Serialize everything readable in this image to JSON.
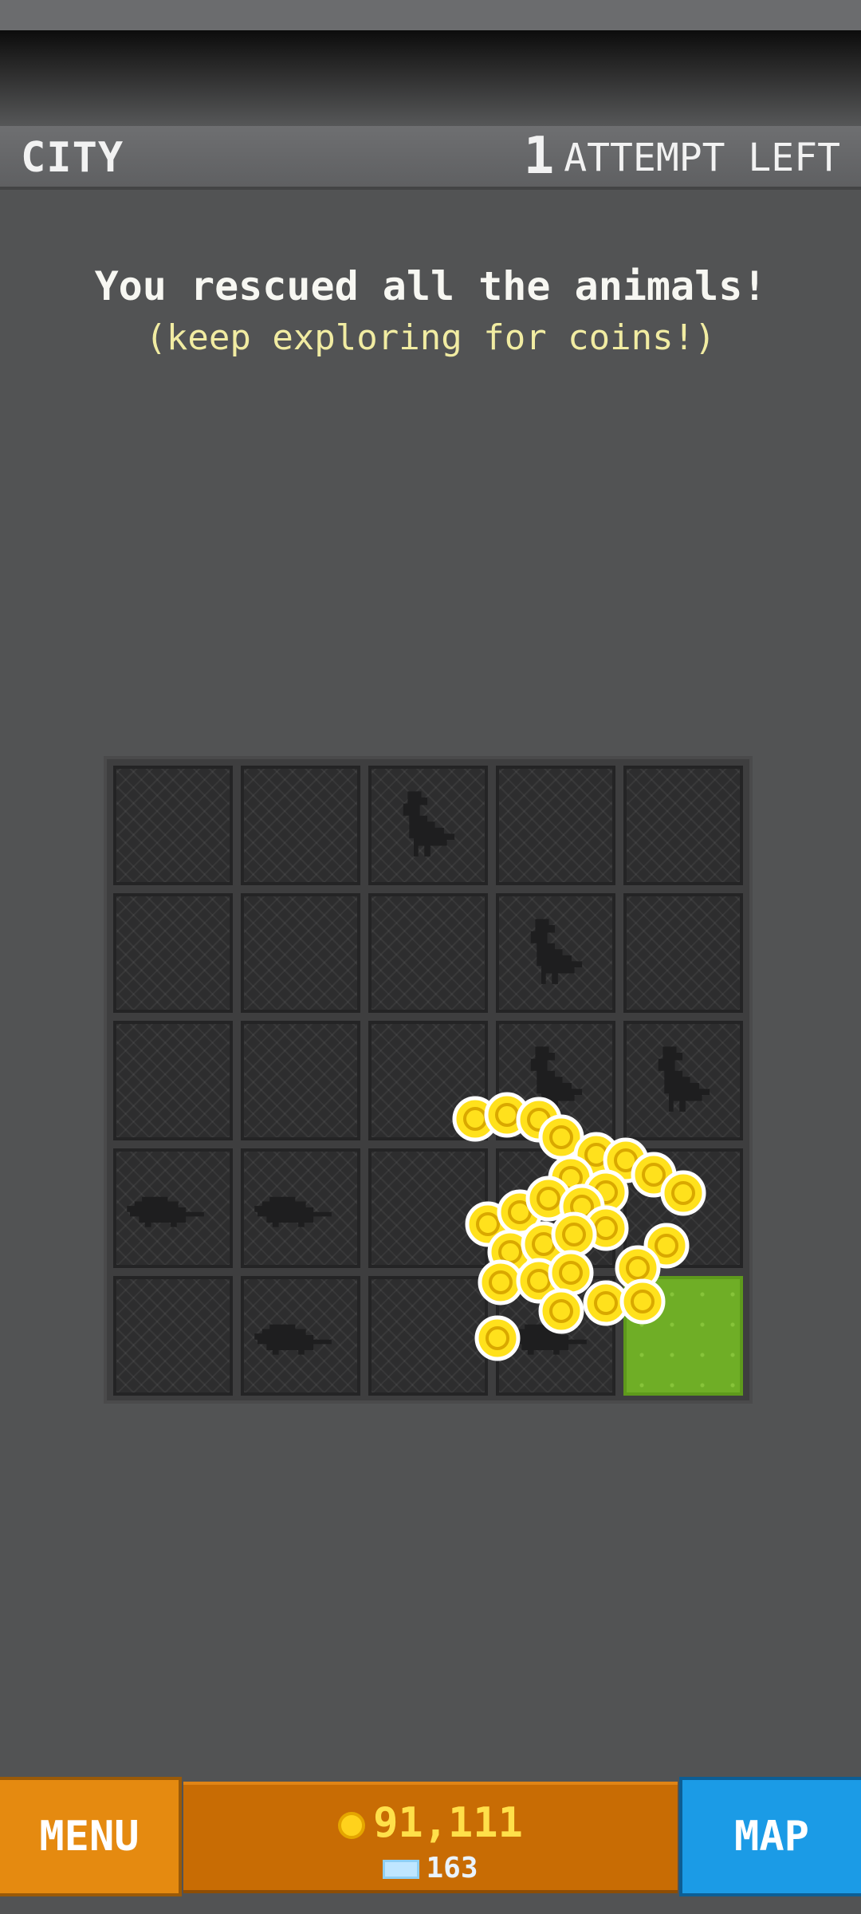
{
  "header": {
    "level_name": "CITY",
    "attempts_count": "1",
    "attempts_label": "ATTEMPT LEFT"
  },
  "message": {
    "line1": "You rescued all the animals!",
    "line2": "(keep exploring for coins!)"
  },
  "board": {
    "rows": 5,
    "cols": 5,
    "tiles": [
      "empty",
      "empty",
      "pigeon",
      "empty",
      "empty",
      "empty",
      "empty",
      "empty",
      "pigeon",
      "empty",
      "empty",
      "empty",
      "empty",
      "pigeon",
      "pigeon",
      "rat",
      "rat",
      "empty",
      "empty",
      "empty",
      "empty",
      "rat",
      "empty",
      "rat",
      "grass"
    ]
  },
  "bottom_bar": {
    "menu_label": "MENU",
    "map_label": "MAP",
    "coins": "91,111",
    "gems": "163"
  },
  "colors": {
    "background": "#525354",
    "menu_button": "#e58a10",
    "map_button": "#1b9be6",
    "coin": "#ffd21c",
    "grass": "#6fae26"
  }
}
